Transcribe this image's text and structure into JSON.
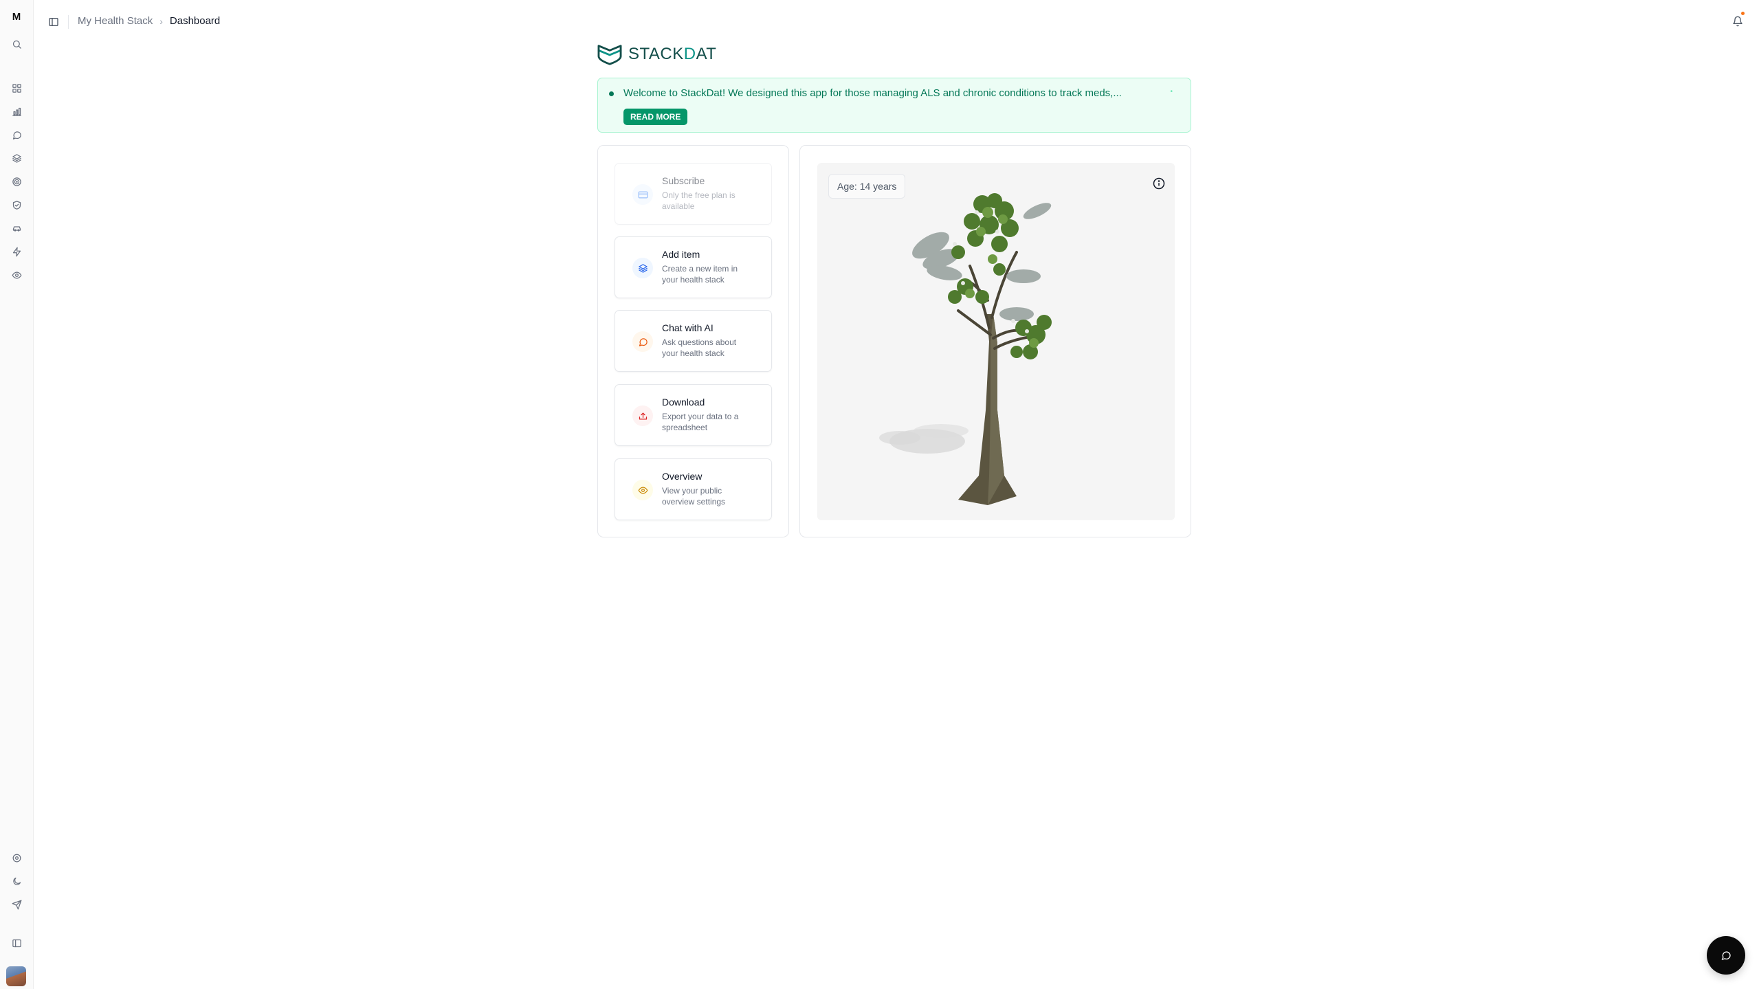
{
  "sidebar": {
    "workspace_initial": "M",
    "top_icons": [
      "search-icon"
    ],
    "nav_icons": [
      "grid-icon",
      "bar-chart-icon",
      "message-circle-icon",
      "layers-icon",
      "target-icon",
      "shield-check-icon",
      "car-icon",
      "zap-icon",
      "eye-icon"
    ],
    "bottom_icons": [
      "settings-icon",
      "moon-icon",
      "send-icon",
      "panel-icon"
    ]
  },
  "header": {
    "breadcrumb": [
      "My Health Stack",
      "Dashboard"
    ]
  },
  "logo": {
    "text_prefix": "STACK",
    "text_accent": "D",
    "text_suffix": "AT"
  },
  "banner": {
    "text": "Welcome to StackDat! We designed this app for those managing ALS and chronic conditions to track meds,...",
    "button": "READ MORE"
  },
  "actions": [
    {
      "title": "Subscribe",
      "desc": "Only the free plan is available",
      "icon": "credit-card-icon",
      "disabled": true
    },
    {
      "title": "Add item",
      "desc": "Create a new item in your health stack",
      "icon": "layers-icon"
    },
    {
      "title": "Chat with AI",
      "desc": "Ask questions about your health stack",
      "icon": "message-circle-icon"
    },
    {
      "title": "Download",
      "desc": "Export your data to a spreadsheet",
      "icon": "download-icon"
    },
    {
      "title": "Overview",
      "desc": "View your public overview settings",
      "icon": "eye-icon"
    }
  ],
  "tree": {
    "age_label": "Age: 14 years"
  },
  "colors": {
    "accent": "#059669",
    "banner_bg": "#ecfdf5",
    "logo_dark": "#134e4a",
    "logo_accent": "#0d9488"
  }
}
